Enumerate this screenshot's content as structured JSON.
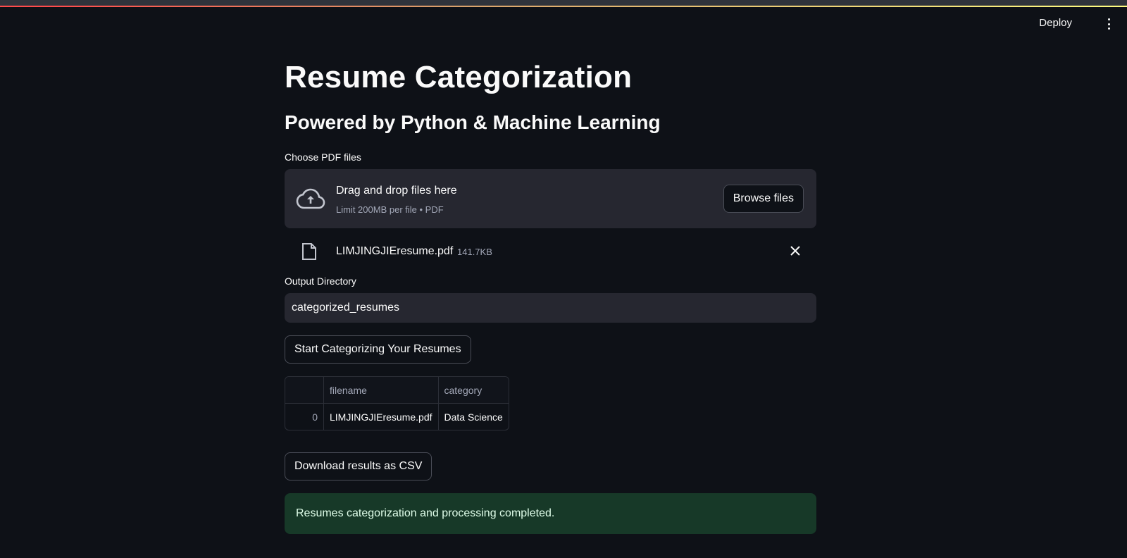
{
  "header": {
    "deploy_label": "Deploy"
  },
  "page": {
    "title": "Resume Categorization",
    "subtitle": "Powered by Python & Machine Learning"
  },
  "uploader": {
    "label": "Choose PDF files",
    "drop_title": "Drag and drop files here",
    "drop_subtitle": "Limit 200MB per file • PDF",
    "browse_label": "Browse files",
    "file": {
      "name": "LIMJINGJIEresume.pdf",
      "size": "141.7KB"
    }
  },
  "output_dir": {
    "label": "Output Directory",
    "value": "categorized_resumes"
  },
  "start_button_label": "Start Categorizing Your Resumes",
  "results_table": {
    "columns": [
      "",
      "filename",
      "category"
    ],
    "rows": [
      {
        "index": "0",
        "filename": "LIMJINGJIEresume.pdf",
        "category": "Data Science"
      }
    ]
  },
  "download_button_label": "Download results as CSV",
  "success_message": "Resumes categorization and processing completed.",
  "colors": {
    "background": "#0e1117",
    "panel": "#262730",
    "success_bg": "#173928",
    "success_text": "#dffde9"
  }
}
